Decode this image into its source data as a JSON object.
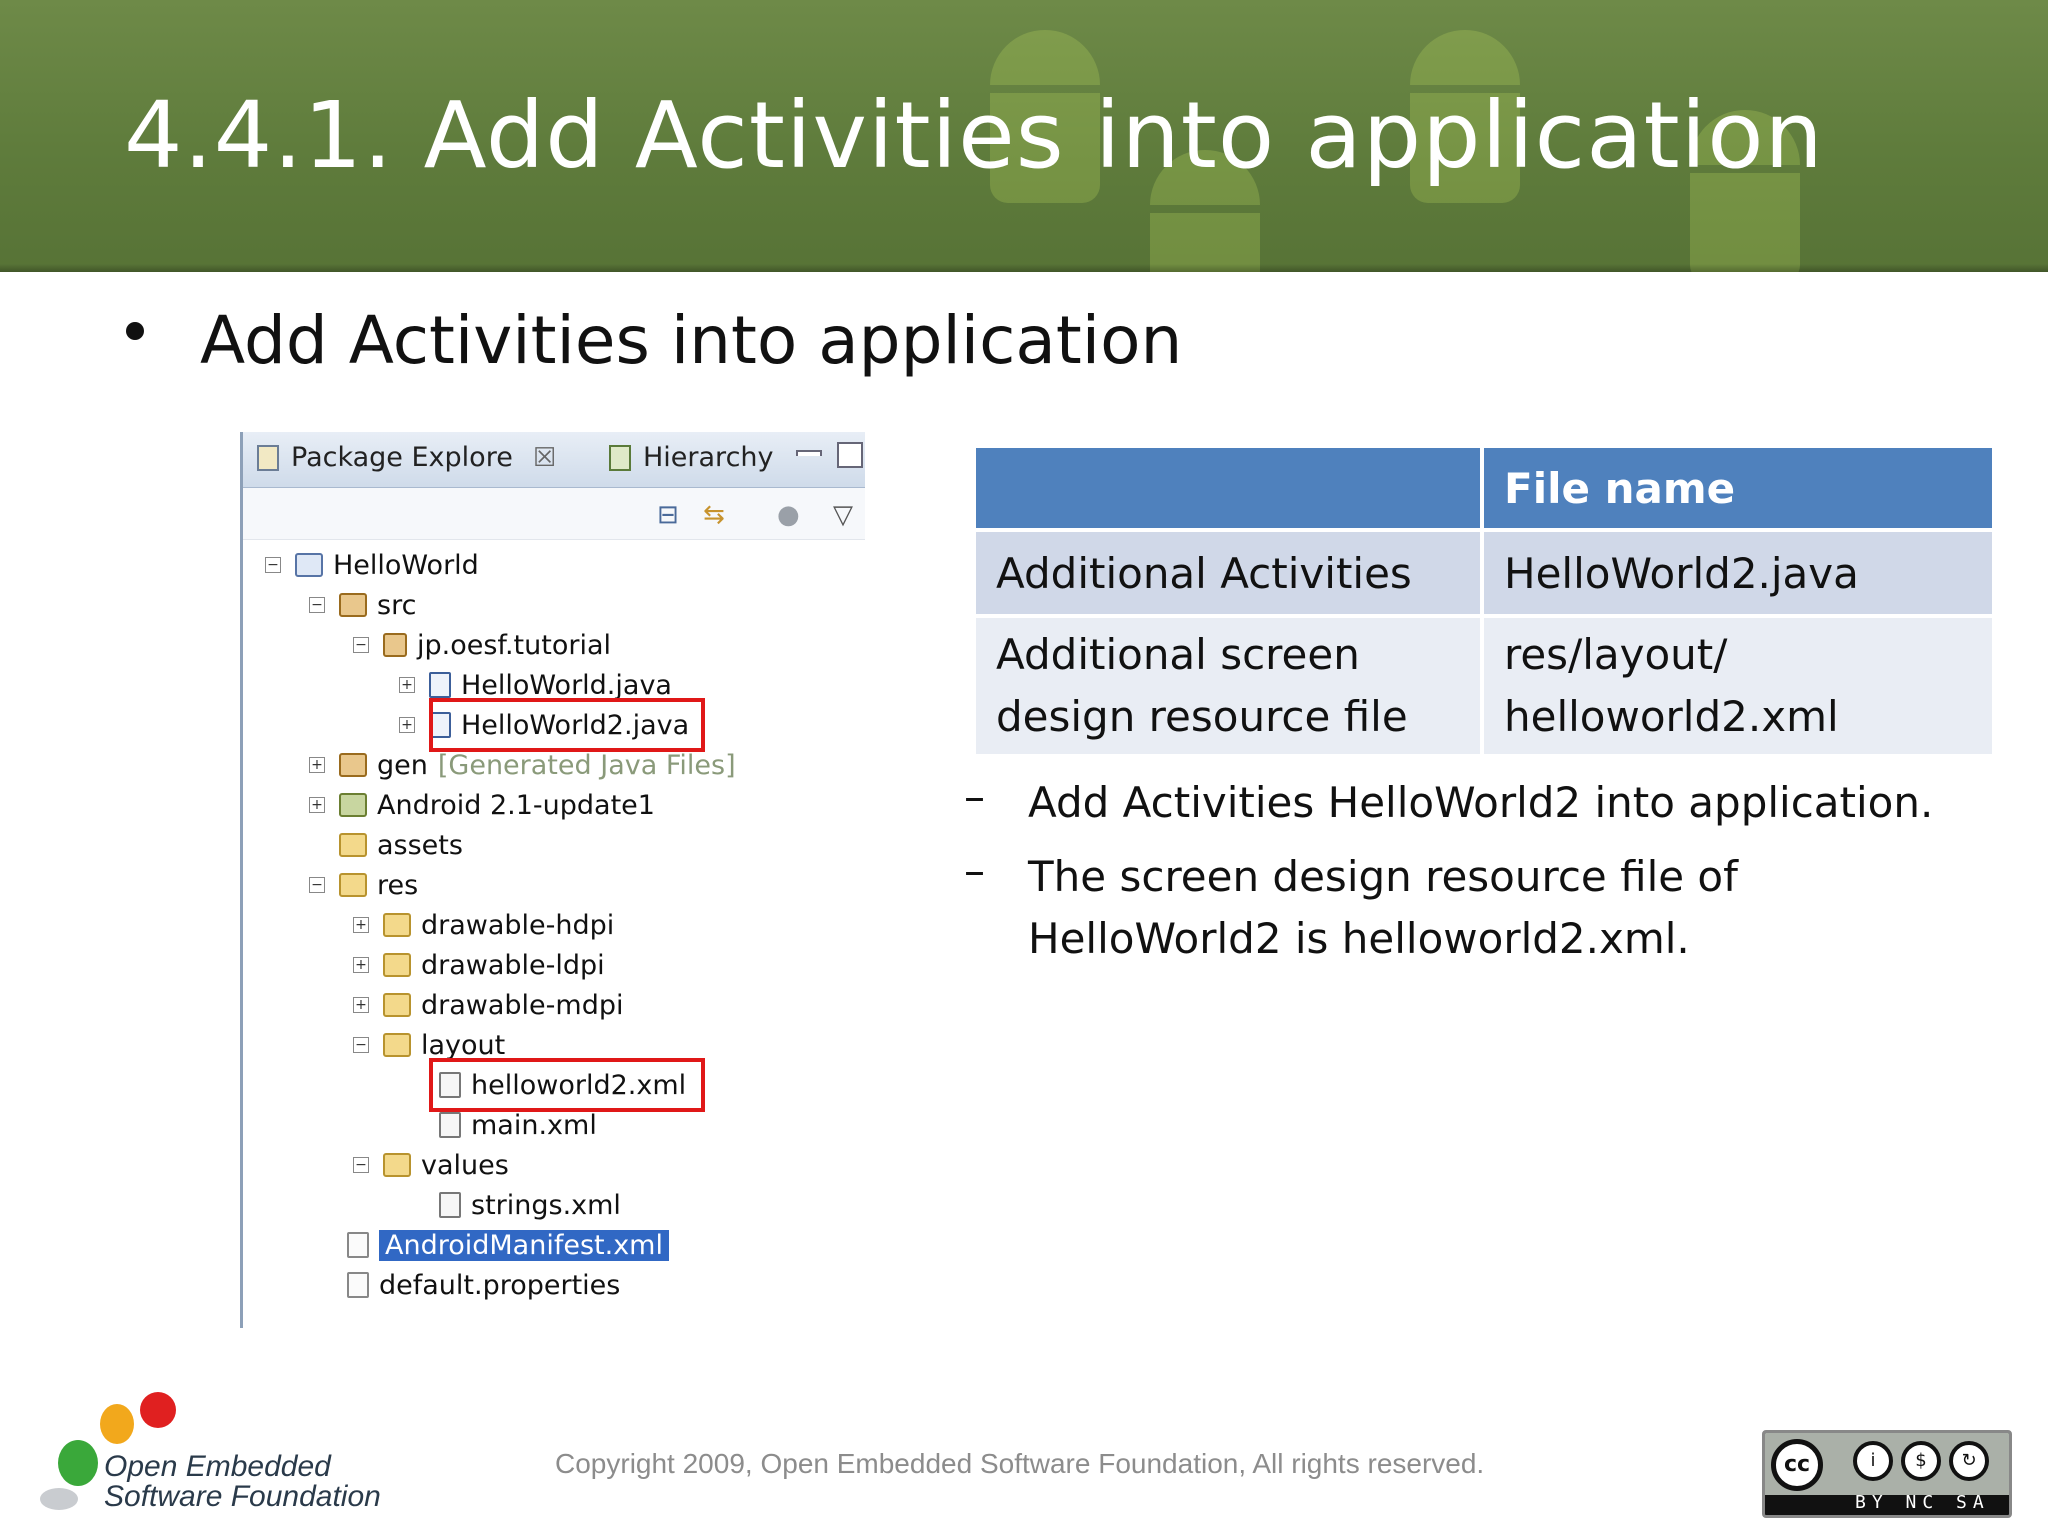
{
  "slide": {
    "title": "4.4.1. Add Activities into application",
    "bullet": "Add Activities into application"
  },
  "explorer": {
    "tabs": [
      {
        "label": "Package Explore",
        "close": "☒"
      },
      {
        "label": "Hierarchy"
      }
    ],
    "tree": [
      {
        "label": "HelloWorld"
      },
      {
        "label": "src"
      },
      {
        "label": "jp.oesf.tutorial"
      },
      {
        "label": "HelloWorld.java"
      },
      {
        "label": "HelloWorld2.java"
      },
      {
        "label": "gen",
        "suffix": "[Generated Java Files]"
      },
      {
        "label": "Android 2.1-update1"
      },
      {
        "label": "assets"
      },
      {
        "label": "res"
      },
      {
        "label": "drawable-hdpi"
      },
      {
        "label": "drawable-ldpi"
      },
      {
        "label": "drawable-mdpi"
      },
      {
        "label": "layout"
      },
      {
        "label": "helloworld2.xml"
      },
      {
        "label": "main.xml"
      },
      {
        "label": "values"
      },
      {
        "label": "strings.xml"
      },
      {
        "label": "AndroidManifest.xml"
      },
      {
        "label": "default.properties"
      }
    ],
    "highlight_color": "#e01818",
    "selection_color": "#3168c4"
  },
  "table": {
    "header": [
      "",
      "File name"
    ],
    "rows": [
      [
        "Additional Activities",
        "HelloWorld2.java"
      ],
      [
        "Additional screen design resource file",
        "res/layout/ helloworld2.xml"
      ]
    ],
    "header_color": "#4f81bd"
  },
  "sub_bullets": [
    {
      "dash": "–",
      "text": "Add Activities HelloWorld2 into application."
    },
    {
      "dash": "–",
      "text": "The screen design resource file of HelloWorld2 is helloworld2.xml."
    }
  ],
  "footer": {
    "logo_line1": "Open Embedded",
    "logo_line2": "Software Foundation",
    "copyright": "Copyright 2009, Open Embedded Software Foundation, All rights reserved.",
    "license_labels": "BY NC SA",
    "cc_mark": "cc"
  }
}
